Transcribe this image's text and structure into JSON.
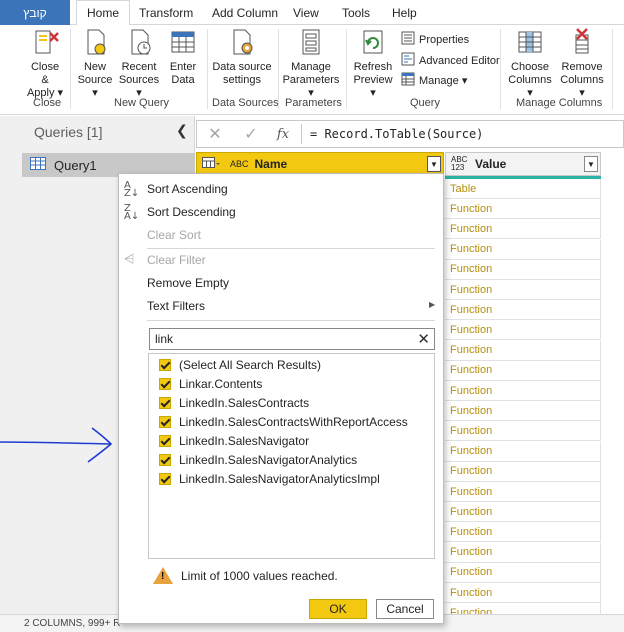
{
  "tabs": {
    "file": "קובץ",
    "items": [
      "Home",
      "Transform",
      "Add Column",
      "View",
      "Tools",
      "Help"
    ],
    "active": "Home"
  },
  "ribbon": {
    "close_apply_1": "Close &",
    "close_apply_2": "Apply",
    "new_source_1": "New",
    "new_source_2": "Source",
    "recent_sources_1": "Recent",
    "recent_sources_2": "Sources",
    "enter_data_1": "Enter",
    "enter_data_2": "Data",
    "ds_settings_1": "Data source",
    "ds_settings_2": "settings",
    "manage_params_1": "Manage",
    "manage_params_2": "Parameters",
    "refresh_1": "Refresh",
    "refresh_2": "Preview",
    "properties": "Properties",
    "advanced_editor": "Advanced Editor",
    "manage": "Manage",
    "choose_cols_1": "Choose",
    "choose_cols_2": "Columns",
    "remove_cols_1": "Remove",
    "remove_cols_2": "Columns",
    "groups": {
      "close": "Close",
      "new_query": "New Query",
      "data_sources": "Data Sources",
      "parameters": "Parameters",
      "query": "Query",
      "manage_columns": "Manage Columns"
    }
  },
  "queries": {
    "title": "Queries [1]",
    "items": [
      "Query1"
    ]
  },
  "formula_bar": {
    "fx": "fx",
    "formula": "= Record.ToTable(Source)"
  },
  "grid": {
    "columns": [
      {
        "type": "ABC",
        "name": "Name"
      },
      {
        "type": "ABC 123",
        "name": "Value"
      }
    ],
    "value_cells": [
      "Table",
      "Function",
      "Function",
      "Function",
      "Function",
      "Function",
      "Function",
      "Function",
      "Function",
      "Function",
      "Function",
      "Function",
      "Function",
      "Function",
      "Function",
      "Function",
      "Function",
      "Function",
      "Function",
      "Function",
      "Function",
      "Function"
    ]
  },
  "status": {
    "text": "2 COLUMNS, 999+ R"
  },
  "filter_menu": {
    "sort_ascending": "Sort Ascending",
    "sort_descending": "Sort Descending",
    "clear_sort": "Clear Sort",
    "clear_filter": "Clear Filter",
    "remove_empty": "Remove Empty",
    "text_filters": "Text Filters",
    "search_value": "link",
    "options": [
      "(Select All Search Results)",
      "Linkar.Contents",
      "LinkedIn.SalesContracts",
      "LinkedIn.SalesContractsWithReportAccess",
      "LinkedIn.SalesNavigator",
      "LinkedIn.SalesNavigatorAnalytics",
      "LinkedIn.SalesNavigatorAnalyticsImpl"
    ],
    "warning": "Limit of 1000 values reached.",
    "ok": "OK",
    "cancel": "Cancel"
  },
  "colors": {
    "accent": "#f2c811",
    "file_tab": "#3b74b8",
    "arrow": "#1f3bd1"
  }
}
